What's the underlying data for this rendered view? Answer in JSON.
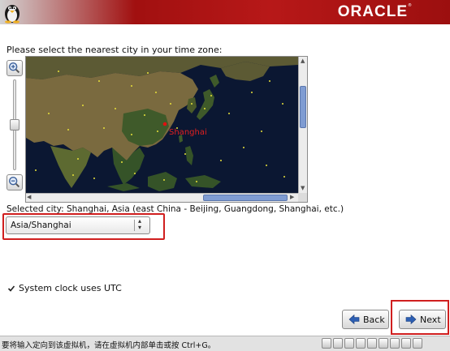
{
  "header": {
    "brand": "ORACLE",
    "trademark": "®"
  },
  "timezone": {
    "prompt": "Please select the nearest city in your time zone:",
    "map_label": "Shanghai",
    "selected_city_text": "Selected city: Shanghai, Asia (east China - Beijing, Guangdong, Shanghai, etc.)",
    "select_value": "Asia/Shanghai"
  },
  "options": {
    "utc_label": "System clock uses UTC",
    "utc_checked": true
  },
  "buttons": {
    "back_label": "Back",
    "next_label": "Next"
  },
  "statusbar": {
    "message": "要将输入定向到该虚拟机，请在虚拟机内部单击或按 Ctrl+G。"
  },
  "colors": {
    "accent_red": "#d01f1f",
    "banner_red": "#a11010",
    "map_ocean": "#0b1732",
    "city_dot": "#e8e23a"
  },
  "icons": [
    "tux-logo-icon",
    "zoom-in-icon",
    "zoom-out-icon",
    "chevron-left-icon",
    "chevron-right-icon",
    "chevron-up-icon",
    "chevron-down-icon",
    "updown-arrows-icon",
    "check-icon",
    "back-arrow-icon",
    "next-arrow-icon"
  ]
}
